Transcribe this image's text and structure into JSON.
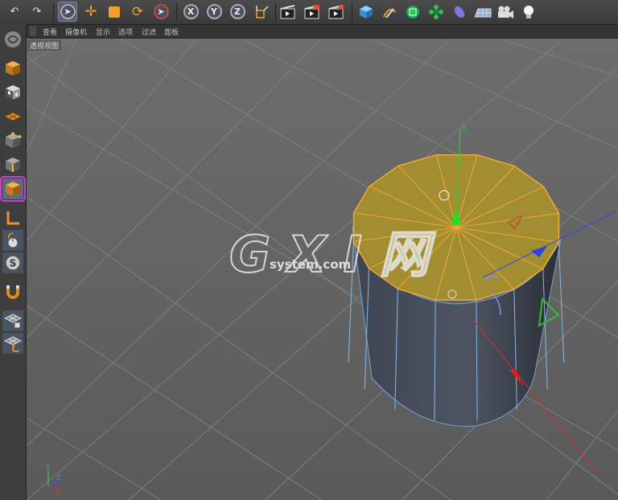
{
  "toolbar": {
    "undo_icon": "undo-arrow-icon",
    "redo_icon": "redo-arrow-icon",
    "axis_x": "X",
    "axis_y": "Y",
    "axis_z": "Z"
  },
  "menubar": {
    "items": [
      "查看",
      "摄像机",
      "显示",
      "选项",
      "过滤",
      "面板"
    ]
  },
  "viewport": {
    "label": "透视视图"
  },
  "watermark": {
    "main": "G X I 网",
    "sub": "system.com"
  },
  "colors": {
    "selection_orange": "#e8a33a",
    "highlight_magenta": "#d23ad6",
    "axis_x": "#e03030",
    "axis_y": "#30d030",
    "axis_z": "#3050e0"
  }
}
